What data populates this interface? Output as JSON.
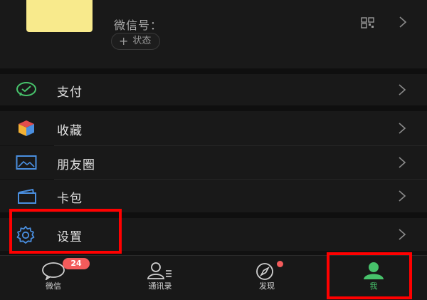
{
  "profile": {
    "wechat_id_label": "微信号：",
    "status_button": "状态",
    "status_plus": "+",
    "qr_icon": "qr-code-icon"
  },
  "menu": {
    "pay": {
      "label": "支付",
      "icon": "wechat-pay-icon",
      "color": "#47c26b"
    },
    "favorites": {
      "label": "收藏",
      "icon": "cube-icon"
    },
    "moments": {
      "label": "朋友圈",
      "icon": "photo-icon",
      "color": "#4a8fe0"
    },
    "cards": {
      "label": "卡包",
      "icon": "card-wallet-icon",
      "color": "#4a8fe0"
    },
    "settings": {
      "label": "设置",
      "icon": "gear-icon",
      "color": "#4a8fe0"
    }
  },
  "tabs": [
    {
      "label": "微信",
      "icon": "chat-bubble-icon",
      "badge": "24"
    },
    {
      "label": "通讯录",
      "icon": "contacts-icon"
    },
    {
      "label": "发现",
      "icon": "compass-icon",
      "dot": true
    },
    {
      "label": "我",
      "icon": "person-icon",
      "active": true,
      "color": "#47c26b"
    }
  ],
  "annotations": {
    "highlight_color": "#ff0000",
    "highlighted": [
      "设置",
      "我"
    ]
  }
}
